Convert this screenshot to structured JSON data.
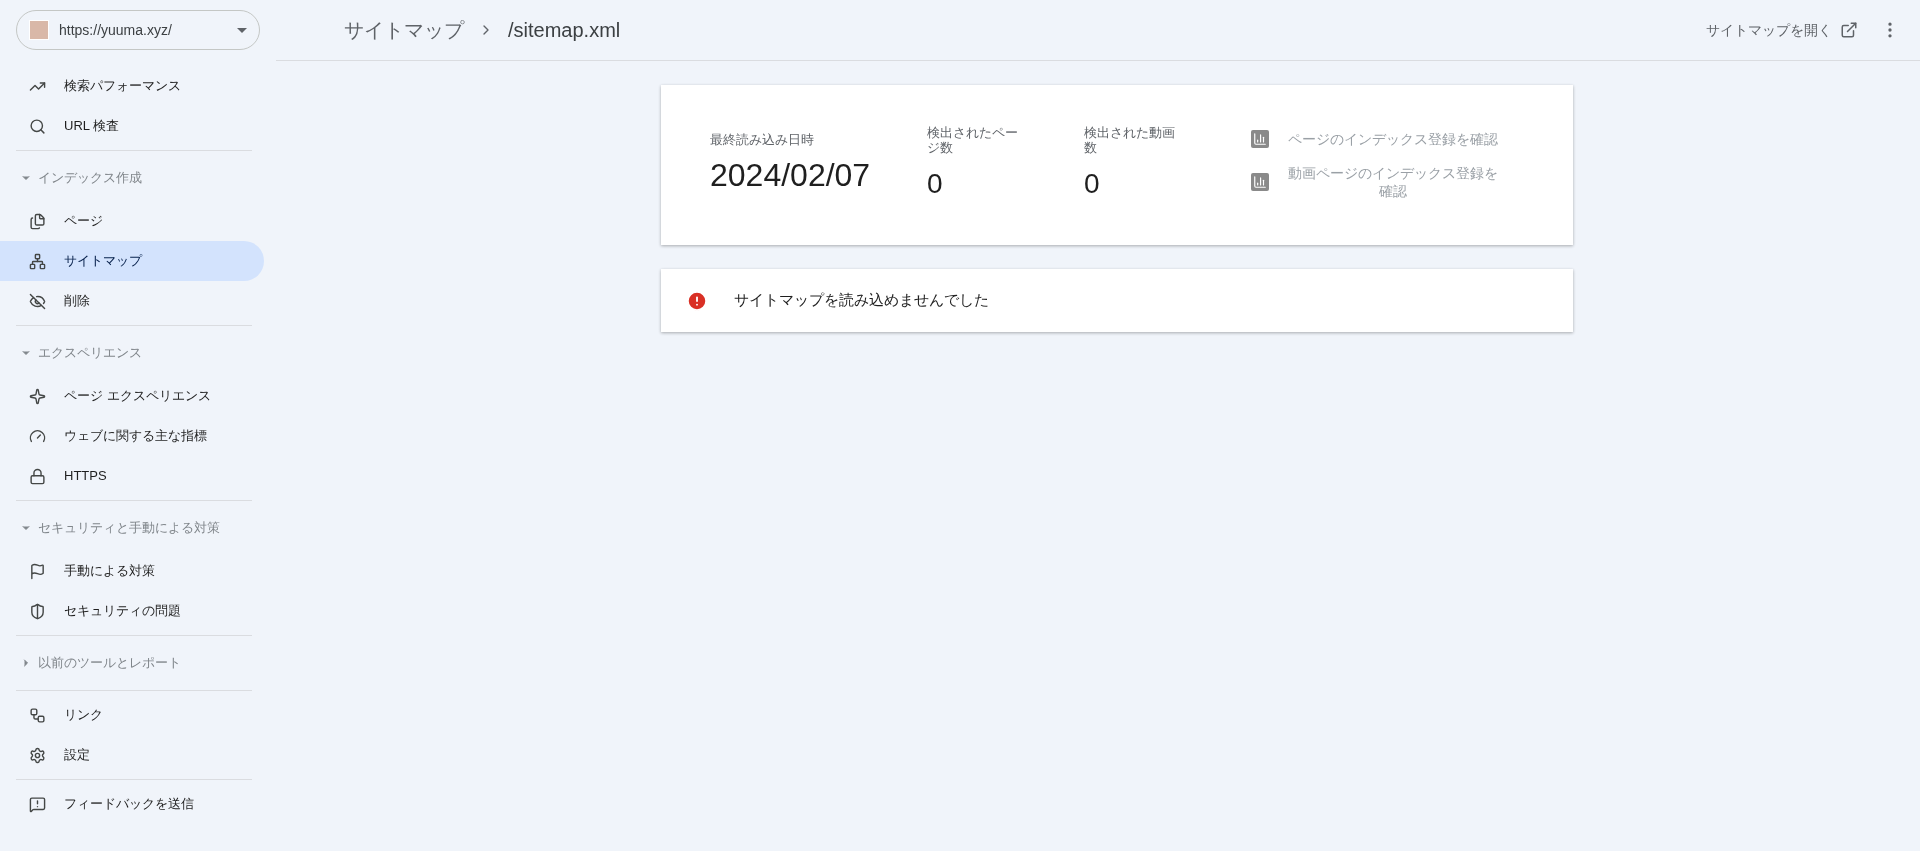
{
  "property_selector": {
    "url": "https://yuuma.xyz/"
  },
  "sidebar": {
    "groups": [
      {
        "items": [
          {
            "label": "検索パフォーマンス",
            "selected": false
          },
          {
            "label": "URL 検査",
            "selected": false
          }
        ]
      },
      {
        "header": {
          "label": "インデックス作成",
          "expanded": true
        },
        "items": [
          {
            "label": "ページ",
            "selected": false
          },
          {
            "label": "サイトマップ",
            "selected": true
          },
          {
            "label": "削除",
            "selected": false
          }
        ]
      },
      {
        "header": {
          "label": "エクスペリエンス",
          "expanded": true
        },
        "items": [
          {
            "label": "ページ エクスペリエンス",
            "selected": false
          },
          {
            "label": "ウェブに関する主な指標",
            "selected": false
          },
          {
            "label": "HTTPS",
            "selected": false
          }
        ]
      },
      {
        "header": {
          "label": "セキュリティと手動による対策",
          "expanded": true
        },
        "items": [
          {
            "label": "手動による対策",
            "selected": false
          },
          {
            "label": "セキュリティの問題",
            "selected": false
          }
        ]
      },
      {
        "header": {
          "label": "以前のツールとレポート",
          "expanded": false
        }
      },
      {
        "items": [
          {
            "label": "リンク",
            "selected": false
          },
          {
            "label": "設定",
            "selected": false
          }
        ]
      },
      {
        "items": [
          {
            "label": "フィードバックを送信",
            "selected": false
          }
        ]
      }
    ]
  },
  "header": {
    "breadcrumb": [
      "サイトマップ",
      "/sitemap.xml"
    ],
    "open_link": "サイトマップを開く"
  },
  "summary": {
    "stats": [
      {
        "label": "最終読み込み日時",
        "value": "2024/02/07"
      },
      {
        "label": "検出されたページ数",
        "value": "0"
      },
      {
        "label": "検出された動画数",
        "value": "0"
      }
    ],
    "links": [
      "ページのインデックス登録を確認",
      "動画ページのインデックス登録を確認"
    ]
  },
  "error": {
    "message": "サイトマップを読み込めませんでした"
  }
}
